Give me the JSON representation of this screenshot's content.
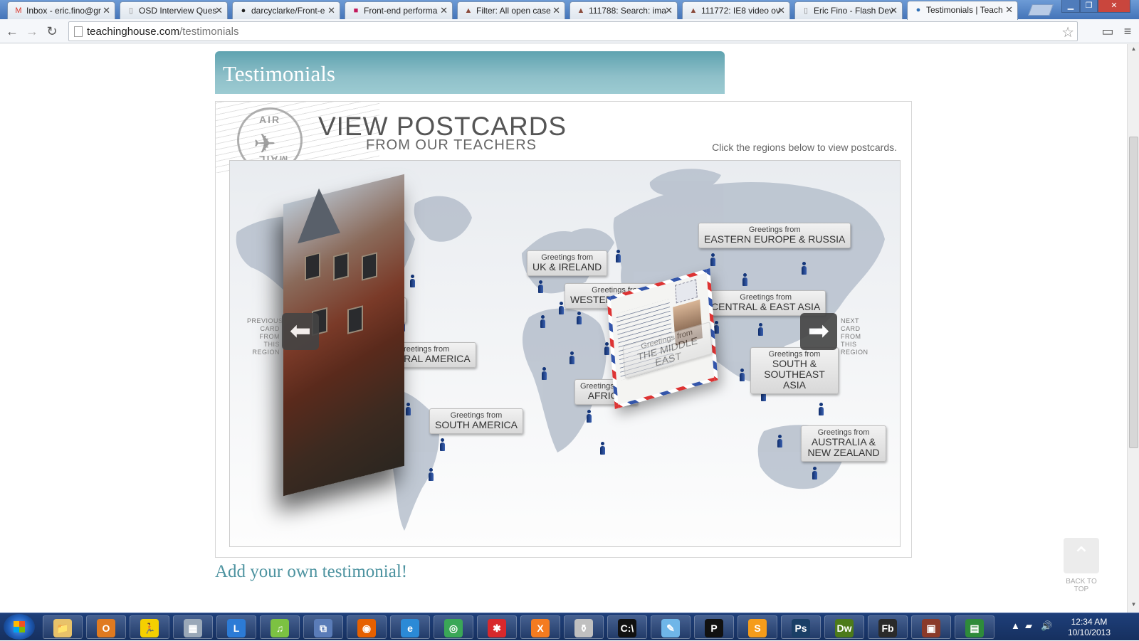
{
  "browser": {
    "tabs": [
      {
        "label": "Inbox - eric.fino@gr",
        "icon": "gmail-icon",
        "icon_char": "M",
        "icon_color": "#d93025"
      },
      {
        "label": "OSD Interview Ques",
        "icon": "doc-icon",
        "icon_char": "▯",
        "icon_color": "#888888"
      },
      {
        "label": "darcyclarke/Front-e",
        "icon": "github-icon",
        "icon_char": "●",
        "icon_color": "#222222"
      },
      {
        "label": "Front-end performa",
        "icon": "slides-icon",
        "icon_char": "■",
        "icon_color": "#c2185b"
      },
      {
        "label": "Filter: All open case",
        "icon": "bug-tracker-icon",
        "icon_char": "▲",
        "icon_color": "#8a4a3a"
      },
      {
        "label": "111788: Search: ima",
        "icon": "bug-tracker-icon",
        "icon_char": "▲",
        "icon_color": "#8a4a3a"
      },
      {
        "label": "111772: IE8 video ov",
        "icon": "bug-tracker-icon",
        "icon_char": "▲",
        "icon_color": "#8a4a3a"
      },
      {
        "label": "Eric Fino - Flash Dev",
        "icon": "doc-icon",
        "icon_char": "▯",
        "icon_color": "#888888"
      },
      {
        "label": "Testimonials | Teach",
        "icon": "teachinghouse-icon",
        "icon_char": "●",
        "icon_color": "#2f6fb5"
      }
    ],
    "url_host": "teachinghouse.com",
    "url_path": "/testimonials"
  },
  "page": {
    "header_title": "Testimonials",
    "postcards_title": "VIEW POSTCARDS",
    "postcards_subtitle": "FROM OUR TEACHERS",
    "airmail_top": "AIR",
    "airmail_bottom": "MAIL",
    "instructions": "Click the regions below to view postcards.",
    "previous_card_text": "PREVIOUS CARD FROM THIS REGION",
    "next_card_text": "NEXT CARD FROM THIS REGION",
    "add_testimonial": "Add your own testimonial!",
    "back_to_top": "BACK TO TOP"
  },
  "regions": [
    {
      "greeting": "Greetings from",
      "name": "UK & IRELAND"
    },
    {
      "greeting": "Greetings from",
      "name": "WESTERN EUROPE"
    },
    {
      "greeting": "Greetings from",
      "name": "EASTERN EUROPE & RUSSIA"
    },
    {
      "greeting": "Greetings from",
      "name": "CENTRAL & EAST ASIA"
    },
    {
      "greeting": "Greetings from",
      "name": "SOUTH & SOUTHEAST ASIA"
    },
    {
      "greeting": "Greetings from",
      "name": "AFRICA"
    },
    {
      "greeting": "Greetings from",
      "name": "SOUTH AMERICA"
    },
    {
      "greeting": "Greetings from",
      "name": "CENTRAL AMERICA"
    },
    {
      "greeting": "from",
      "name": "SA"
    },
    {
      "greeting": "Greetings from",
      "name": "AUSTRALIA & NEW ZEALAND"
    },
    {
      "greeting": "Greetings from",
      "name": "THE MIDDLE EAST"
    }
  ],
  "taskbar": {
    "apps": [
      {
        "name": "explorer",
        "glyph": "📁",
        "color": "#e8c26a"
      },
      {
        "name": "outlook",
        "glyph": "O",
        "color": "#e07a20"
      },
      {
        "name": "aim",
        "glyph": "🏃",
        "color": "#f5d000"
      },
      {
        "name": "calculator",
        "glyph": "▦",
        "color": "#9aa8b8"
      },
      {
        "name": "lync",
        "glyph": "L",
        "color": "#2c7bd6"
      },
      {
        "name": "spotify",
        "glyph": "♫",
        "color": "#7cc242"
      },
      {
        "name": "network",
        "glyph": "⧉",
        "color": "#5a7cb8"
      },
      {
        "name": "firefox",
        "glyph": "◉",
        "color": "#e66000"
      },
      {
        "name": "ie",
        "glyph": "e",
        "color": "#2b8ad6"
      },
      {
        "name": "chrome",
        "glyph": "◎",
        "color": "#3aa757"
      },
      {
        "name": "app-red",
        "glyph": "✱",
        "color": "#d8282c"
      },
      {
        "name": "xampp",
        "glyph": "X",
        "color": "#f47b20"
      },
      {
        "name": "jar",
        "glyph": "⚱",
        "color": "#c0c0c0"
      },
      {
        "name": "terminal",
        "glyph": "C:\\",
        "color": "#111111"
      },
      {
        "name": "notepad",
        "glyph": "✎",
        "color": "#6fb6e8"
      },
      {
        "name": "p-app",
        "glyph": "P",
        "color": "#111111"
      },
      {
        "name": "sublime",
        "glyph": "S",
        "color": "#f59c1a"
      },
      {
        "name": "photoshop",
        "glyph": "Ps",
        "color": "#1a3f66"
      },
      {
        "name": "dreamweaver",
        "glyph": "Dw",
        "color": "#4c7a1a"
      },
      {
        "name": "flash-builder",
        "glyph": "Fb",
        "color": "#2a2a2a"
      },
      {
        "name": "media-app",
        "glyph": "▣",
        "color": "#8a3a2a"
      },
      {
        "name": "task-manager",
        "glyph": "▤",
        "color": "#2e8b3a"
      }
    ],
    "time": "12:34 AM",
    "date": "10/10/2013"
  }
}
